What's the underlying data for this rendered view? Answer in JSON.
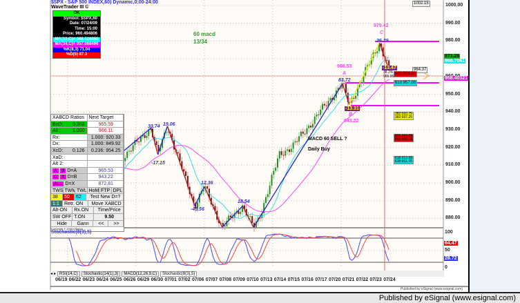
{
  "header": {
    "title": "$SPX - S&P 500 INDEX,60) Dynamic,0:00-24:00",
    "study": "WaveTrader III ©"
  },
  "info_box": {
    "status": "OK",
    "symbol": "Symbol: $SPX,60",
    "date": "Date: 07/24/09",
    "time": "Time: 15:00",
    "price": "Price: 960.494806",
    "ma13": "MA(13,C)= 968.528858",
    "ma34": "MA(34,C)= 957.068496",
    "k": "%K(8,3) 71.04",
    "d": "%D(5) 87.3"
  },
  "xabcd": {
    "header_left": "XABCD Ratios",
    "header_right": "Next Target",
    "rows": [
      {
        "label": "BcD:",
        "value": "0.382",
        "target": "965.59"
      },
      {
        "label": "Alt :",
        "value": "1.000",
        "target": "966.11"
      },
      {
        "label": "Rx:",
        "value": "",
        "target": "1.000: 920.33"
      },
      {
        "label": "Dx:",
        "value": "",
        "target": "1.000: 849.92"
      },
      {
        "label": "XcD:",
        "value": "0.126",
        "target": "0.236: 954.25"
      },
      {
        "label": "XaD:",
        "value": "",
        "target": ""
      },
      {
        "label": "Alt 2:",
        "value": "",
        "target": ""
      }
    ],
    "proj": [
      {
        "a": "A",
        "b": "B",
        "lbl": "D=A",
        "val": "965.53"
      },
      {
        "a": "C",
        "b": "X",
        "lbl": "D=B",
        "val": "943.22"
      },
      {
        "a": "ALL",
        "b": "",
        "lbl": "D=X",
        "val": "872.81"
      }
    ],
    "buttons1": [
      "TWS",
      "TWM",
      "TWL",
      "HoMe",
      "FTP",
      "DPL"
    ],
    "fib": [
      "38",
      "50",
      "62"
    ],
    "test_label": "Test New D=?",
    "one_one": "1:1",
    "retr": "Retr. ON",
    "move": "Move XABCD",
    "alt_on": "Alt-ON",
    "rx_on": "Rx.ON",
    "time_price": "Time/Price",
    "sw_off": "SW OFF",
    "t_on": "T.ON",
    "step": "9.50",
    "hide": "Hide",
    "gann": "Gann",
    "prev": "<<",
    "next": ">>",
    "copyright": "Copyright © 2005 eSignal"
  },
  "annotations": {
    "macd60": "60 macd",
    "macd_periods": "13/34",
    "sell": "MACD 60 SELL ?",
    "daily_buy": "Daily Buy",
    "p1": "33.74",
    "p2": "-17.15",
    "p3": "19.06",
    "p4": "-45.56",
    "p5": "12.36",
    "p6": "18.54",
    "p7": "83.72",
    "p8": "-13.31",
    "p9": "36.29",
    "p10": "-13.47",
    "a_price": "966.53",
    "a": "A",
    "b": "B",
    "b_price": "943.22",
    "c_price": "979.42",
    "c": "C",
    "pct": "38.2%",
    "d_price": "965.95"
  },
  "tags": {
    "top": "1002.15",
    "t964": "964.37",
    "r500": "500:964.28",
    "c618": "618:957.08",
    "y382a": "382:933.75",
    "y382b": "382:937.25",
    "r500a": "500:924.08",
    "r500b": "500:923.78",
    "c618a": "618:913.58",
    "c618b": "618:911.75"
  },
  "price_axis": {
    "ticks": [
      "1000.00",
      "990.00",
      "980.00",
      "970.00",
      "960.00",
      "950.00",
      "940.00",
      "930.00",
      "920.00",
      "910.00",
      "900.00",
      "890.00",
      "880.00"
    ],
    "last_green": "971.26",
    "ma13": "968.7061",
    "ma34": "958.40321"
  },
  "stoch": {
    "title": "Stochastic(8(3),5)",
    "ticks": [
      "100",
      "50",
      "0"
    ],
    "d_val": "64.47",
    "k_val": "28.72"
  },
  "tabs": [
    "RSI(14,C)",
    "Stochastic(14(1),3)",
    "MACD(12,26,9,C)",
    "Stochastic(8(3),5)"
  ],
  "dates": [
    "06/19",
    "06/22",
    "06/23",
    "06/24",
    "06/25",
    "06/26",
    "06/29",
    "06/30",
    "07/01",
    "07/02",
    "07/06",
    "07/07",
    "07/08",
    "07/09",
    "07/10",
    "07/13",
    "07/14",
    "07/15",
    "07/16",
    "07/17",
    "07/20",
    "07/21",
    "07/22",
    "07/23",
    "07/24"
  ],
  "publisher": "Published by eSignal (www.esignal.com)",
  "publisher_small": "Published by eSignal (www.esignal.com)",
  "chart_data": {
    "type": "candlestick",
    "symbol": "$SPX",
    "interval": "60",
    "ylim": [
      875,
      1002
    ],
    "pivots": [
      [
        -0.7,
        918
      ],
      [
        0.5,
        928
      ],
      [
        1.7,
        893
      ],
      [
        3,
        902
      ],
      [
        6.6,
        931
      ],
      [
        7.1,
        916
      ],
      [
        7.8,
        932
      ],
      [
        9.8,
        887
      ],
      [
        10.5,
        898
      ],
      [
        11.8,
        875
      ],
      [
        13.3,
        887
      ],
      [
        14.1,
        875
      ],
      [
        14.5,
        880
      ],
      [
        16,
        916
      ],
      [
        17,
        921
      ],
      [
        20.6,
        956
      ],
      [
        21.1,
        944
      ],
      [
        23.3,
        979
      ],
      [
        24,
        964
      ]
    ],
    "colors": {
      "ma13": "#33e0e8",
      "ma34": "#ff44ff",
      "stoch_k": "#4444ff",
      "stoch_d": "#ff4444",
      "up": "#2a8a2a",
      "down": "#7a1010"
    }
  }
}
